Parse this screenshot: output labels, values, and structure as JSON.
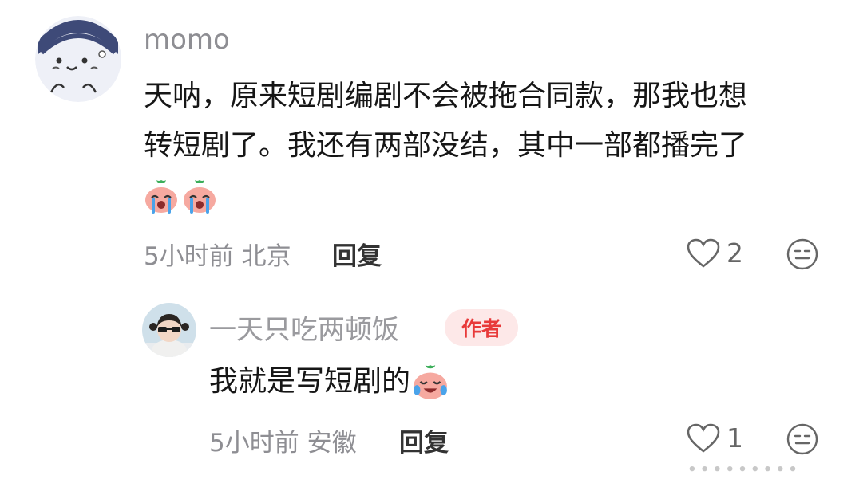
{
  "comments": [
    {
      "username": "momo",
      "text_line1": "天呐，原来短剧编剧不会被拖合同款，那我也想",
      "text_line2": "转短剧了。我还有两部没结，其中一部都播完了",
      "emojis": [
        "crying-peach-emoji",
        "crying-peach-emoji"
      ],
      "time": "5小时前",
      "location": "北京",
      "reply_label": "回复",
      "like_count": "2",
      "avatar_icon": "cartoon-face-avatar"
    },
    {
      "username": "一天只吃两顿饭",
      "badge": "作者",
      "text": "我就是写短剧的",
      "emojis": [
        "crying-laughing-peach-emoji"
      ],
      "time": "5小时前",
      "location": "安徽",
      "reply_label": "回复",
      "like_count": "1",
      "avatar_icon": "girl-photo-avatar"
    }
  ],
  "watermark": "∙∙∙∙∙∙∙∙∙",
  "colors": {
    "meta_gray": "#8e8e93",
    "badge_bg": "#fde8e8",
    "badge_text": "#e83a3a",
    "text": "#161616"
  }
}
